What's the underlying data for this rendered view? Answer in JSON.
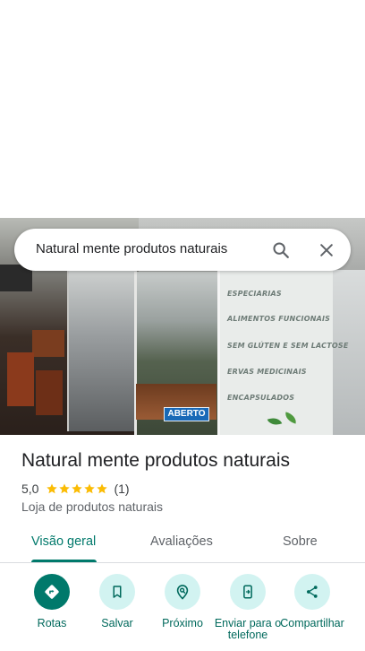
{
  "search": {
    "query": "Natural mente produtos naturais"
  },
  "photo": {
    "open_badge": "ABERTO",
    "sign_lines": [
      "ESPECIARIAS",
      "ALIMENTOS FUNCIONAIS",
      "SEM GLÚTEN E SEM LACTOSE",
      "ERVAS MEDICINAIS",
      "ENCAPSULADOS"
    ]
  },
  "place": {
    "name": "Natural mente produtos naturais",
    "rating": "5,0",
    "stars": 5,
    "review_count": "(1)",
    "category": "Loja de produtos naturais"
  },
  "tabs": [
    {
      "label": "Visão geral",
      "active": true
    },
    {
      "label": "Avaliações",
      "active": false
    },
    {
      "label": "Sobre",
      "active": false
    }
  ],
  "actions": [
    {
      "label": "Rotas",
      "icon": "directions-icon"
    },
    {
      "label": "Salvar",
      "icon": "bookmark-icon"
    },
    {
      "label": "Próximo",
      "icon": "nearby-search-icon"
    },
    {
      "label": "Enviar para o telefone",
      "icon": "phone-send-icon"
    },
    {
      "label": "Compartilhar",
      "icon": "share-icon"
    }
  ],
  "colors": {
    "accent": "#00796b",
    "accent_light": "#d2f3f1",
    "star": "#fbbc04",
    "open_badge": "#1969b7"
  }
}
